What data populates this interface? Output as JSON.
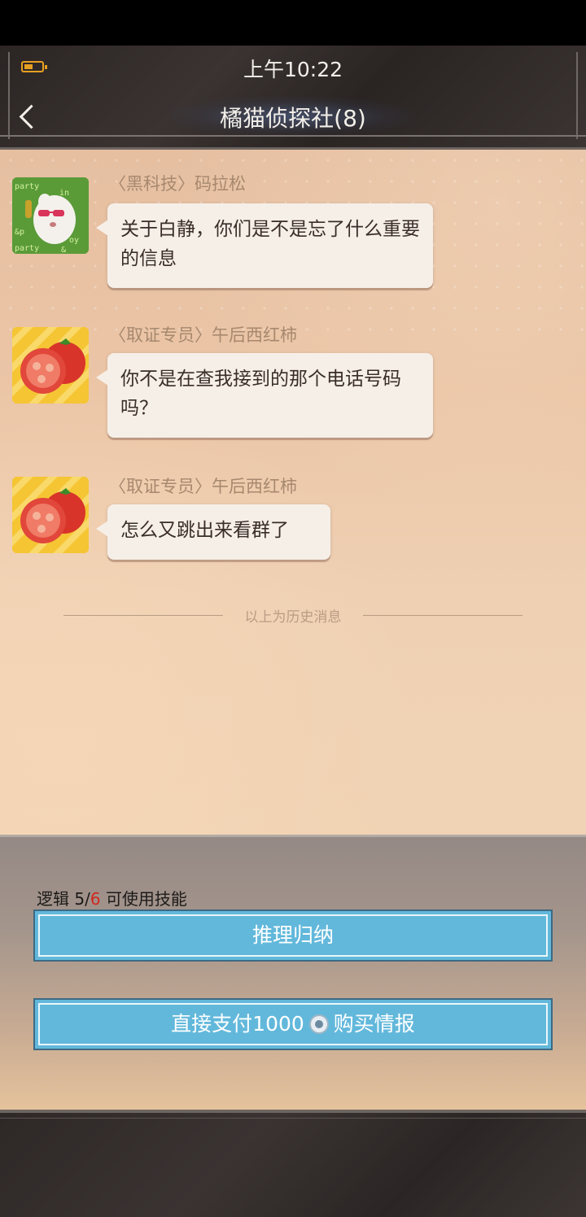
{
  "status_bar": {
    "time": "上午10:22",
    "battery_icon": "battery-low-icon"
  },
  "header": {
    "back_icon": "chevron-left-icon",
    "title": "橘猫侦探社(8)"
  },
  "messages": [
    {
      "sender": "〈黑科技〉码拉松",
      "avatar": "party-character-avatar",
      "text": "关于白静，你们是不是忘了什么重要的信息"
    },
    {
      "sender": "〈取证专员〉午后西红柿",
      "avatar": "tomato-avatar",
      "text": "你不是在查我接到的那个电话号码吗？"
    },
    {
      "sender": "〈取证专员〉午后西红柿",
      "avatar": "tomato-avatar",
      "text": "怎么又跳出来看群了"
    }
  ],
  "history_divider": "以上为历史消息",
  "skill_panel": {
    "logic_label": "逻辑",
    "logic_current": "5",
    "logic_sep": "/",
    "logic_required": "6",
    "logic_suffix": "可使用技能",
    "reason_button": "推理归纳",
    "buy_prefix": "直接支付1000",
    "buy_suffix": "购买情报",
    "coin_icon": "coin-icon"
  },
  "colors": {
    "button_blue": "#62b8db",
    "required_red": "#d2261f"
  }
}
